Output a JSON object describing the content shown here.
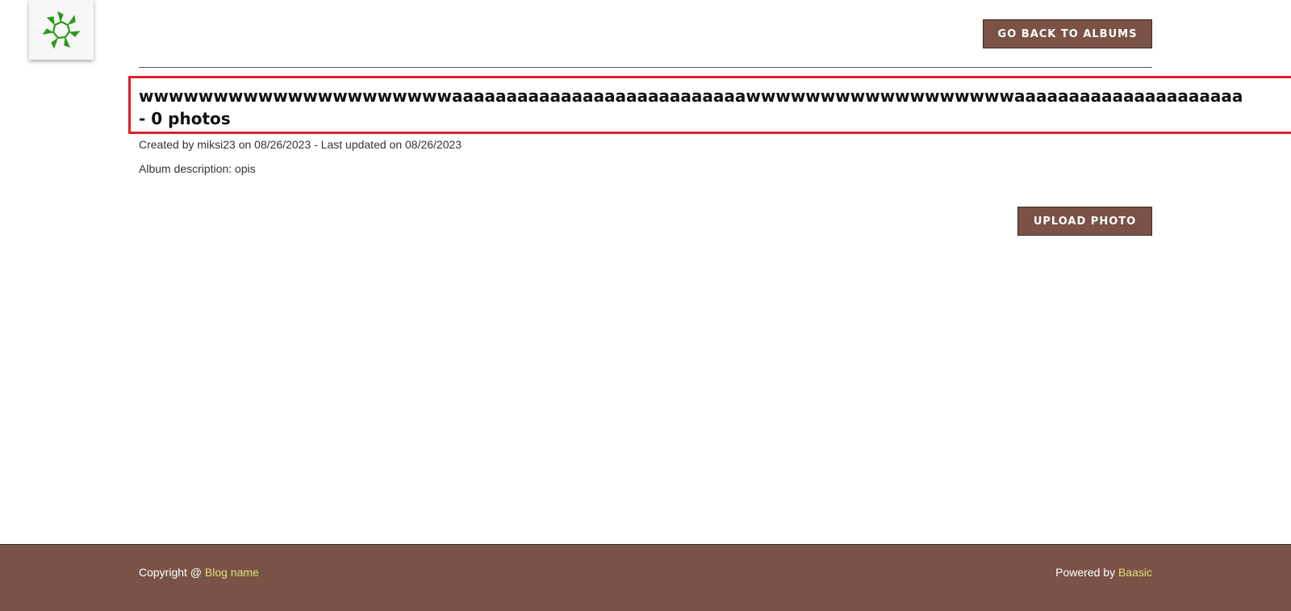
{
  "header": {
    "logo_icon": "sun-burst-logo-icon",
    "back_button_label": "GO BACK TO ALBUMS"
  },
  "album": {
    "title": "wwwwwwwwwwwwwwwwwwwwwaaaaaaaaaaaaaaaaaaaaaaaaaaawwwwwwwwwwwwwwwwwwaaaaaaaaaaaaaaaaaaaaa",
    "photo_count_text": "- 0 photos",
    "created_text": "Created by miksi23 on 08/26/2023 - Last updated on 08/26/2023",
    "description_text": "Album description: opis",
    "upload_button_label": "UPLOAD PHOTO"
  },
  "footer": {
    "copyright_prefix": "Copyright @ ",
    "blog_link": "Blog name",
    "powered_prefix": "Powered by ",
    "baasic_link": "Baasic"
  },
  "colors": {
    "accent_brown": "#7a5346",
    "highlight_red": "#d9232d",
    "link_yellow": "#d8e07a",
    "logo_green": "#2a9a1a"
  }
}
